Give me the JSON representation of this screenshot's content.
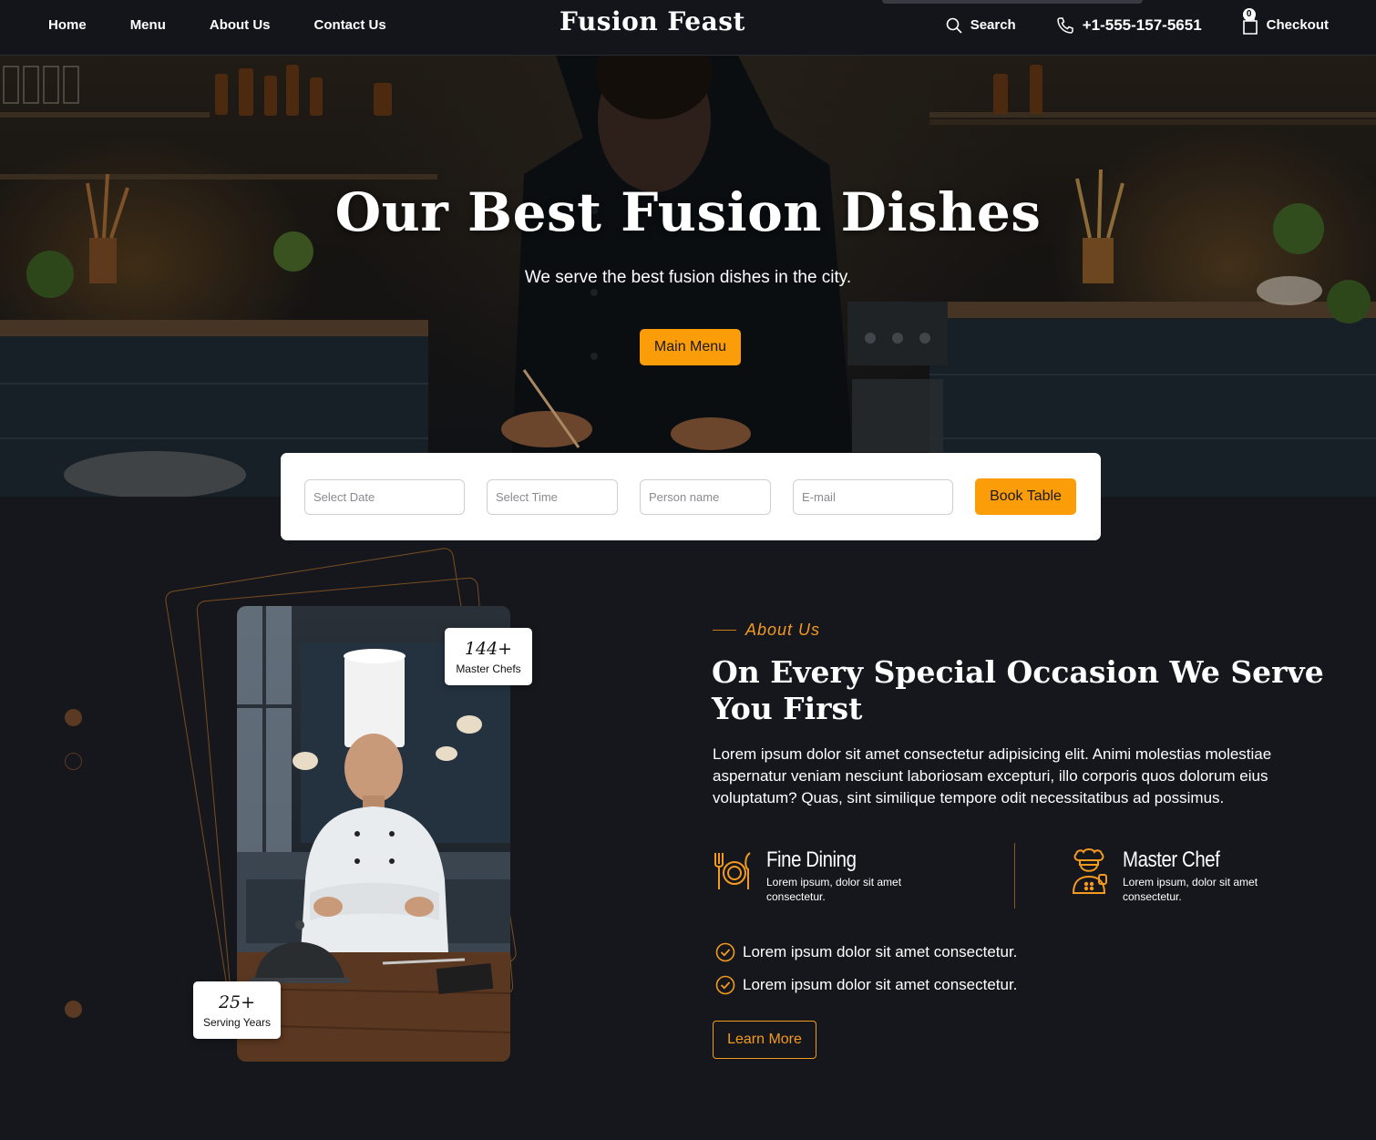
{
  "header": {
    "nav": [
      "Home",
      "Menu",
      "About Us",
      "Contact Us"
    ],
    "brand": "Fusion Feast",
    "search_label": "Search",
    "phone": "+1-555-157-5651",
    "cart_count": "0",
    "checkout_label": "Checkout"
  },
  "hero": {
    "title": "Our Best Fusion Dishes",
    "subtitle": "We serve the best fusion dishes in the city.",
    "cta_label": "Main Menu"
  },
  "booking": {
    "date_placeholder": "Select Date",
    "time_placeholder": "Select Time",
    "name_placeholder": "Person name",
    "email_placeholder": "E-mail",
    "button_label": "Book Table"
  },
  "stats": {
    "chefs_value": "144+",
    "chefs_label": "Master Chefs",
    "years_value": "25+",
    "years_label": "Serving Years"
  },
  "about": {
    "eyebrow": "About Us",
    "title": "On Every Special Occasion We Serve You First",
    "body": "Lorem ipsum dolor sit amet consectetur adipisicing elit. Animi molestias molestiae aspernatur veniam nesciunt laboriosam excepturi, illo corporis quos dolorum eius voluptatum? Quas, sint similique tempore odit necessitatibus ad possimus.",
    "features": [
      {
        "title": "Fine Dining",
        "desc": "Lorem ipsum, dolor sit amet consectetur.",
        "icon": "dining-plate-icon"
      },
      {
        "title": "Master Chef",
        "desc": "Lorem ipsum, dolor sit amet consectetur.",
        "icon": "chef-icon"
      }
    ],
    "checks": [
      "Lorem ipsum dolor sit amet consectetur.",
      "Lorem ipsum dolor sit amet consectetur."
    ],
    "cta_label": "Learn More"
  },
  "colors": {
    "accent": "#fb9c09",
    "background": "#16171d",
    "frame": "#7a4e21"
  }
}
